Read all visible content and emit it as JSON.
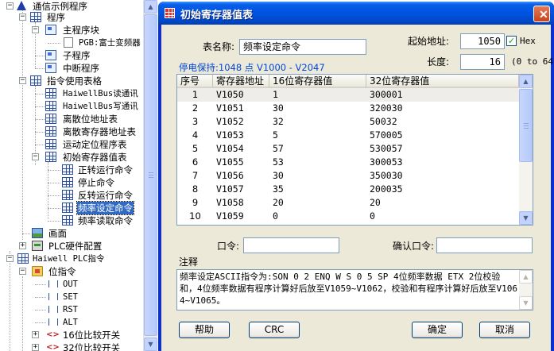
{
  "tree": {
    "root": "通信示例程序",
    "program": "程序",
    "main_block": "主程序块",
    "pgb": "PGB:富士变频器",
    "subroutine": "子程序",
    "interrupt": "中断程序",
    "instruction_tables": "指令使用表格",
    "haiwell_read": "HaiwellBus读通讯",
    "haiwell_write": "HaiwellBus写通讯",
    "discrete_table": "离散位地址表",
    "discrete_reg_table": "离散寄存器地址表",
    "motion_table": "运动定位程序表",
    "init_reg_table": "初始寄存器值表",
    "fwd_cmd": "正转运行命令",
    "stop_cmd": "停止命令",
    "rev_cmd": "反转运行命令",
    "freq_set_cmd": "频率设定命令",
    "freq_read_cmd": "频率读取命令",
    "screen": "画面",
    "plc_hw": "PLC硬件配置",
    "haiwell_plc": "Haiwell PLC指令",
    "bit_instr": "位指令",
    "out": "OUT",
    "set": "SET",
    "rst": "RST",
    "alt": "ALT",
    "cmp16": "16位比较开关",
    "cmp32": "32位比较开关"
  },
  "dialog": {
    "title": "初始寄存器值表",
    "close": "✕",
    "table_name_label": "表名称:",
    "table_name_value": "频率设定命令",
    "start_addr_label": "起始地址:",
    "start_addr_value": "1050",
    "hex_label": "Hex",
    "hex_checked": "✓",
    "length_label": "长度:",
    "length_value": "16",
    "length_range": "(0 to 64)",
    "retention": "停电保持:1048 点 V1000 - V2047",
    "columns": [
      "序号",
      "寄存器地址",
      "16位寄存器值",
      "32位寄存器值"
    ],
    "rows": [
      [
        "1",
        "V1050",
        "1",
        "300001"
      ],
      [
        "2",
        "V1051",
        "30",
        "320030"
      ],
      [
        "3",
        "V1052",
        "32",
        "50032"
      ],
      [
        "4",
        "V1053",
        "5",
        "570005"
      ],
      [
        "5",
        "V1054",
        "57",
        "530057"
      ],
      [
        "6",
        "V1055",
        "53",
        "300053"
      ],
      [
        "7",
        "V1056",
        "30",
        "350030"
      ],
      [
        "8",
        "V1057",
        "35",
        "200035"
      ],
      [
        "9",
        "V1058",
        "20",
        "20"
      ],
      [
        "10",
        "V1059",
        "0",
        "0"
      ]
    ],
    "password_label": "口令:",
    "password_value": "",
    "confirm_label": "确认口令:",
    "confirm_value": "",
    "note_label": "注释",
    "note_text": "频率设定ASCII指令为:SON 0 2 ENQ W S 0 5 SP 4位频率数据 ETX 2位校验和，4位频率数据有程序计算好后放至V1059~V1062，校验和有程序计算好后放至V1064~V1065。",
    "buttons": {
      "help": "帮助",
      "crc": "CRC",
      "ok": "确定",
      "cancel": "取消"
    }
  },
  "scroll": {
    "up": "▲",
    "down": "▼"
  }
}
